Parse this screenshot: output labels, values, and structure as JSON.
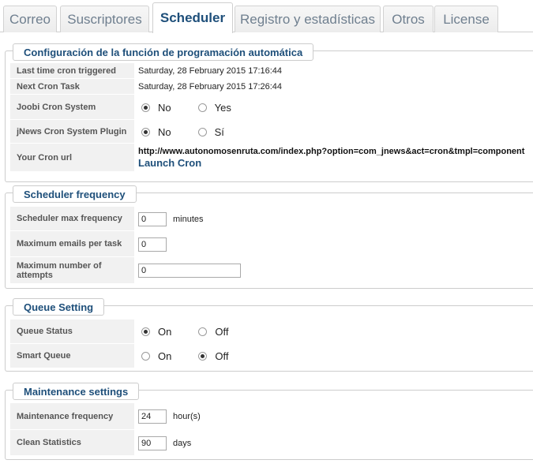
{
  "tabs": [
    "Correo",
    "Suscriptores",
    "Scheduler",
    "Registro y estadísticas",
    "Otros",
    "License"
  ],
  "active_tab": "Scheduler",
  "auto_section": {
    "title": "Configuración de la función de programación automática",
    "last_triggered": {
      "label": "Last time cron triggered",
      "value": "Saturday, 28 February 2015 17:16:44"
    },
    "next_task": {
      "label": "Next Cron Task",
      "value": "Saturday, 28 February 2015 17:26:44"
    },
    "joobi": {
      "label": "Joobi Cron System",
      "opt1": "No",
      "opt2": "Yes",
      "selected": "No"
    },
    "jnews_plugin": {
      "label": "jNews Cron System Plugin",
      "opt1": "No",
      "opt2": "Sí",
      "selected": "No"
    },
    "cron_url": {
      "label": "Your Cron url",
      "url": "http://www.autonomosenruta.com/index.php?option=com_jnews&act=cron&tmpl=component",
      "link": "Launch Cron"
    }
  },
  "frequency_section": {
    "title": "Scheduler frequency",
    "max_freq": {
      "label": "Scheduler max frequency",
      "value": "0",
      "unit": "minutes"
    },
    "max_emails": {
      "label": "Maximum emails per task",
      "value": "0"
    },
    "max_attempts": {
      "label": "Maximum number of attempts",
      "value": "0"
    }
  },
  "queue_section": {
    "title": "Queue Setting",
    "queue_status": {
      "label": "Queue Status",
      "opt1": "On",
      "opt2": "Off",
      "selected": "On"
    },
    "smart_queue": {
      "label": "Smart Queue",
      "opt1": "On",
      "opt2": "Off",
      "selected": "Off"
    }
  },
  "maintenance_section": {
    "title": "Maintenance settings",
    "frequency": {
      "label": "Maintenance frequency",
      "value": "24",
      "unit": "hour(s)"
    },
    "clean_stats": {
      "label": "Clean Statistics",
      "value": "90",
      "unit": "days"
    }
  }
}
